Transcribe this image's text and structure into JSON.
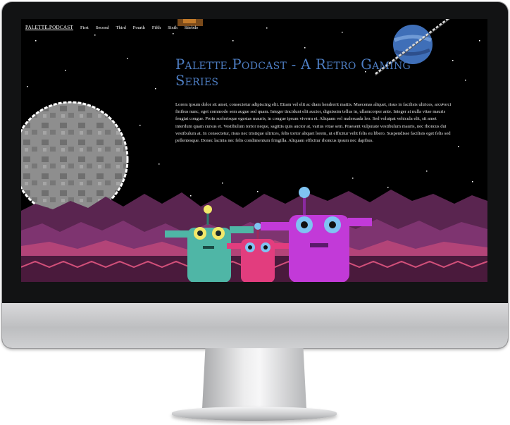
{
  "nav": {
    "brand": "PALETTE.PODCAST",
    "links": [
      "First",
      "Second",
      "Third",
      "Fourth",
      "Fifth",
      "Sixth",
      "Stiebtle"
    ]
  },
  "hero": {
    "title": "Palette.Podcast - A Retro Gaming Series",
    "body": "Lorem ipsum dolor sit amet, consectetur adipiscing elit. Etiam vel elit ac diam hendrerit mattis. Maecenas aliquet, risus in facilisis ultrices, arcu orci finibus nunc, eget commodo sem augue sed quam. Integer tincidunt elit auctor, dignissim tellus in, ullamcorper ante. Integer at nulla vitae mauris feugiat congue. Proin scelerisque egestas mauris, in congue ipsum viverra et. Aliquam vel malesuada leo. Sed volutpat vehicula elit, sit amet interdum quam cursus et. Vestibulum tortor neque, sagittis quis auctor at, varius vitae sem. Praesent vulputate vestibulum mauris, nec rhoncus dui vestibulum at. In consectetur, risus nec tristique ultrices, felis tortor aliquet lorem, ut efficitur velit felis eu libero. Suspendisse facilisis eget felis sed pellentesque. Donec lacinia nec felis condimentum fringilla. Aliquam efficitur rhoncus ipsum nec dapibus."
  },
  "colors": {
    "title": "#4e7ec3",
    "monitor_bezel": "#121314",
    "screen_bg": "#000000",
    "mountain_far": "#5a2550",
    "mountain_mid": "#8a3a78",
    "mountain_near": "#c0487e",
    "ground": "#4a1a3c",
    "moon": "#8f8f8f",
    "alien_teal": "#4fb6a6",
    "alien_pink": "#e23d7e",
    "alien_purple": "#c23ad8"
  },
  "illustration": {
    "elements": [
      "moon",
      "ringed-planet",
      "mountains",
      "teal-alien",
      "pink-alien",
      "purple-alien",
      "stars"
    ]
  }
}
